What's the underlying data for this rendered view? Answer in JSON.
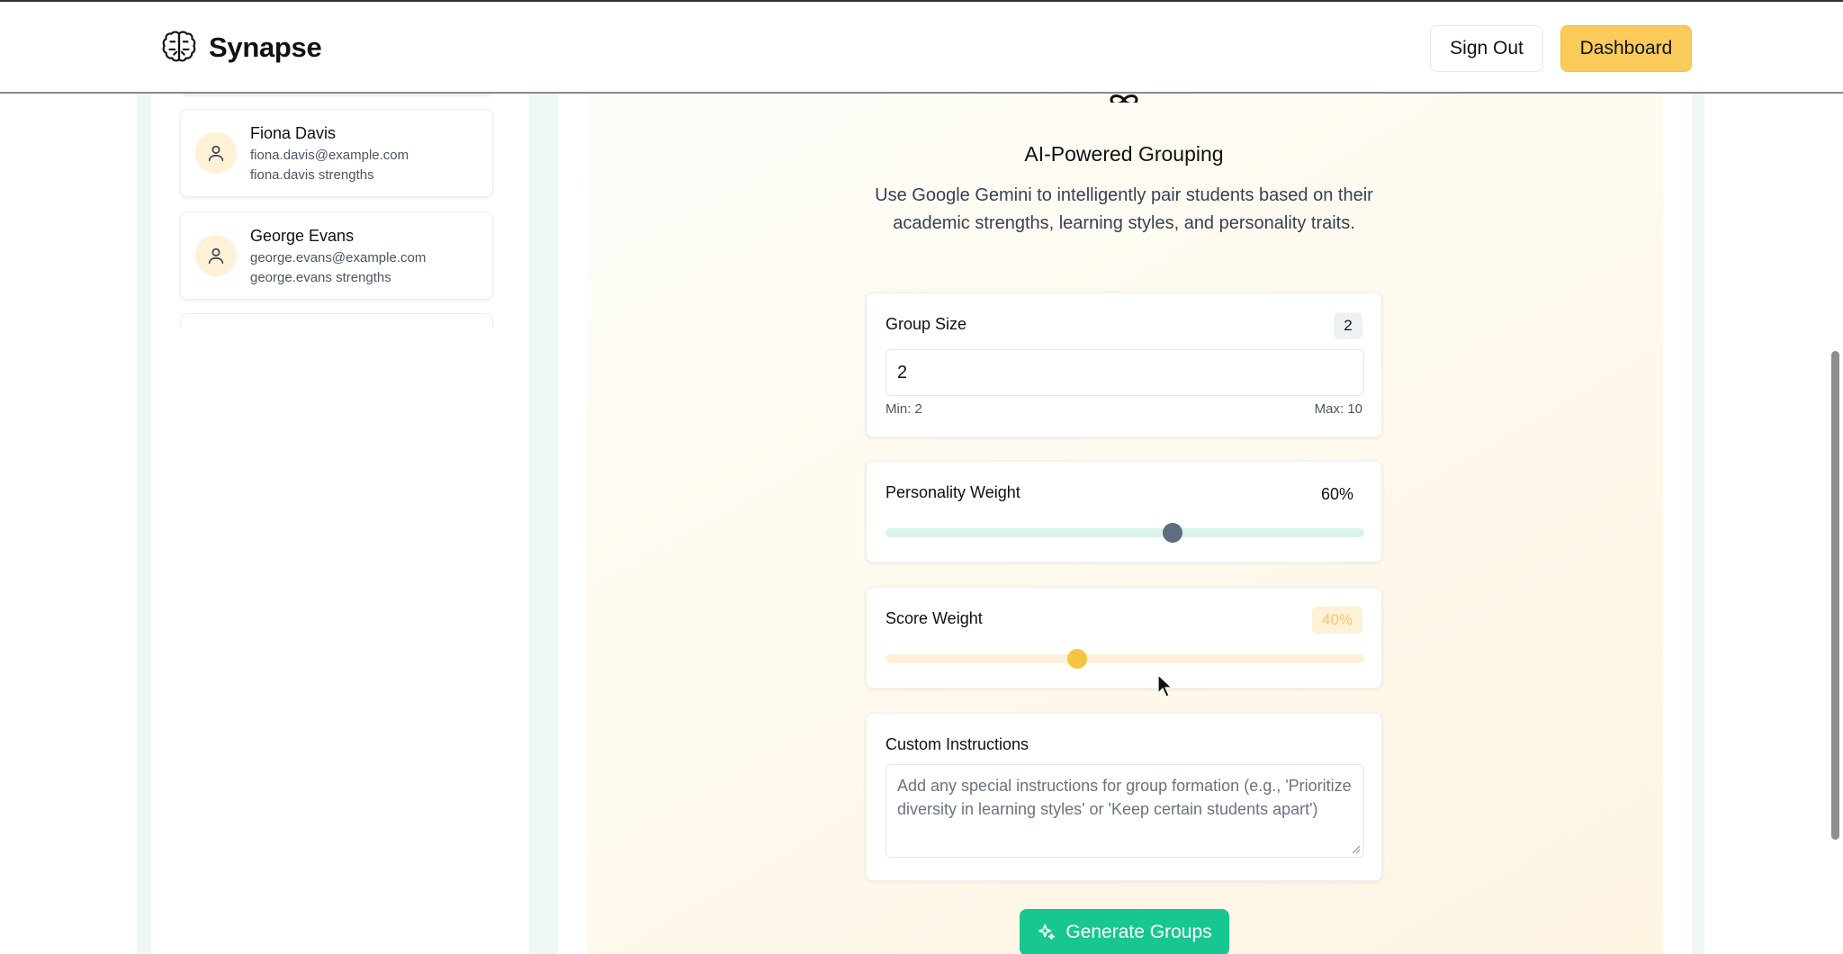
{
  "header": {
    "brand_name": "Synapse",
    "sign_out_label": "Sign Out",
    "dashboard_label": "Dashboard"
  },
  "students": [
    {
      "name": "Fiona Davis",
      "email": "fiona.davis@example.com",
      "strengths": "fiona.davis strengths"
    },
    {
      "name": "George Evans",
      "email": "george.evans@example.com",
      "strengths": "george.evans strengths"
    }
  ],
  "grouping": {
    "title": "AI-Powered Grouping",
    "description": "Use Google Gemini to intelligently pair students based on their academic strengths, learning styles, and personality traits."
  },
  "group_size": {
    "label": "Group Size",
    "badge": "2",
    "value": "2",
    "min_label": "Min: 2",
    "max_label": "Max: 10"
  },
  "personality_weight": {
    "label": "Personality Weight",
    "value_text": "60%",
    "value": 0.6
  },
  "score_weight": {
    "label": "Score Weight",
    "value_text": "40%",
    "value": 0.4
  },
  "custom_instructions": {
    "label": "Custom Instructions",
    "placeholder": "Add any special instructions for group formation (e.g., 'Prioritize diversity in learning styles' or 'Keep certain students apart')"
  },
  "generate_label": "Generate Groups",
  "colors": {
    "accent_yellow": "#fbcb5a",
    "accent_green": "#18c691",
    "personality_track": "#d9f3ea",
    "personality_thumb": "#5f6e7e",
    "score_track": "#fdf0d6",
    "score_thumb": "#f5c542"
  }
}
